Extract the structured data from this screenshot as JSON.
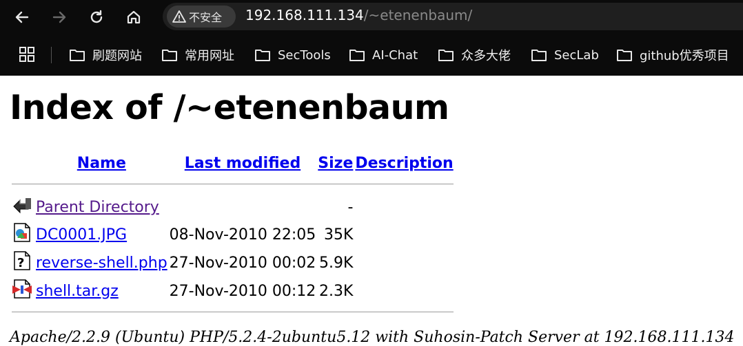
{
  "browser": {
    "security_label": "不安全",
    "url_host": "192.168.111.134",
    "url_path": "/~etenenbaum/",
    "bookmarks": [
      "刷题网站",
      "常用网址",
      "SecTools",
      "AI-Chat",
      "众多大佬",
      "SecLab",
      "github优秀项目"
    ]
  },
  "page": {
    "title": "Index of /~etenenbaum",
    "columns": {
      "name": "Name",
      "last_modified": "Last modified",
      "size": "Size",
      "description": "Description"
    },
    "rows": [
      {
        "name": "Parent Directory",
        "modified": "",
        "size": "-",
        "icon": "back-icon"
      },
      {
        "name": "DC0001.JPG",
        "modified": "08-Nov-2010 22:05",
        "size": "35K",
        "icon": "image-file-icon"
      },
      {
        "name": "reverse-shell.php",
        "modified": "27-Nov-2010 00:02",
        "size": "5.9K",
        "icon": "unknown-file-icon"
      },
      {
        "name": "shell.tar.gz",
        "modified": "27-Nov-2010 00:12",
        "size": "2.3K",
        "icon": "compressed-file-icon"
      }
    ],
    "footer": "Apache/2.2.9 (Ubuntu) PHP/5.2.4-2ubuntu5.12 with Suhosin-Patch Server at 192.168.111.134"
  }
}
